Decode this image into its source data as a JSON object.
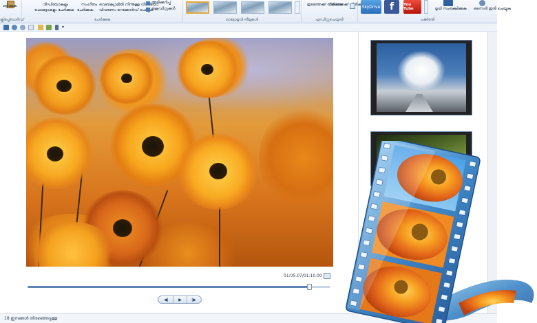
{
  "ribbon": {
    "groups": [
      {
        "name": "clipboard",
        "label": "ക്ലിപ്പ്ബോർഡ്",
        "buttons": [
          "ഒട്ടിക്കുക"
        ]
      },
      {
        "name": "add",
        "label": "ചേർക്കുക",
        "buttons": [
          "വീഡിയോകളും",
          "ഫോട്ടോകളും ചേർക്കുക",
          "ചേർക്കുക",
          "സംഗീതം",
          "വെബ്ക്യാമിൽ നിന്നുള്ള വീഡിയോ",
          "വിവരണം റെക്കോർഡ് ചെയ്യുക",
          "അടിക്കുറിപ്പ്",
          "ക്രെഡിറ്റുകൾ"
        ]
      },
      {
        "name": "automovie-themes",
        "label": "ഓട്ടോമൂവി തീമുകൾ",
        "buttons": []
      },
      {
        "name": "editing",
        "label": "എഡിറ്റുചെയ്യൽ",
        "buttons": [
          "ഇടത്തേക്ക് തിരിക്കുക",
          "വലത്തേക്ക് തിരിക്കുക"
        ]
      },
      {
        "name": "share",
        "label": "പങ്കിടൽ",
        "buttons": [
          "SkyDrive",
          "മൂവി സംരക്ഷിക്കുക",
          "സൈൻ ഇൻ ചെയ്യുക"
        ]
      }
    ],
    "logos": {
      "skydrive": "SkyDrive",
      "facebook": "f",
      "youtube": "You Tube"
    }
  },
  "preview": {
    "timecode": "01:05.07/01:10.00",
    "progress": 0.93
  },
  "playback": {
    "prev_icon": "previous-frame-icon",
    "play_icon": "play-icon",
    "next_icon": "next-frame-icon"
  },
  "status": {
    "text": "18 ഇനങ്ങൾ തിരഞ്ഞെടുത്തു"
  },
  "colors": {
    "accent": "#3c6fb0",
    "selection": "#e7a73b",
    "film": "#4f8fc9",
    "flower": "#f3a21f"
  }
}
